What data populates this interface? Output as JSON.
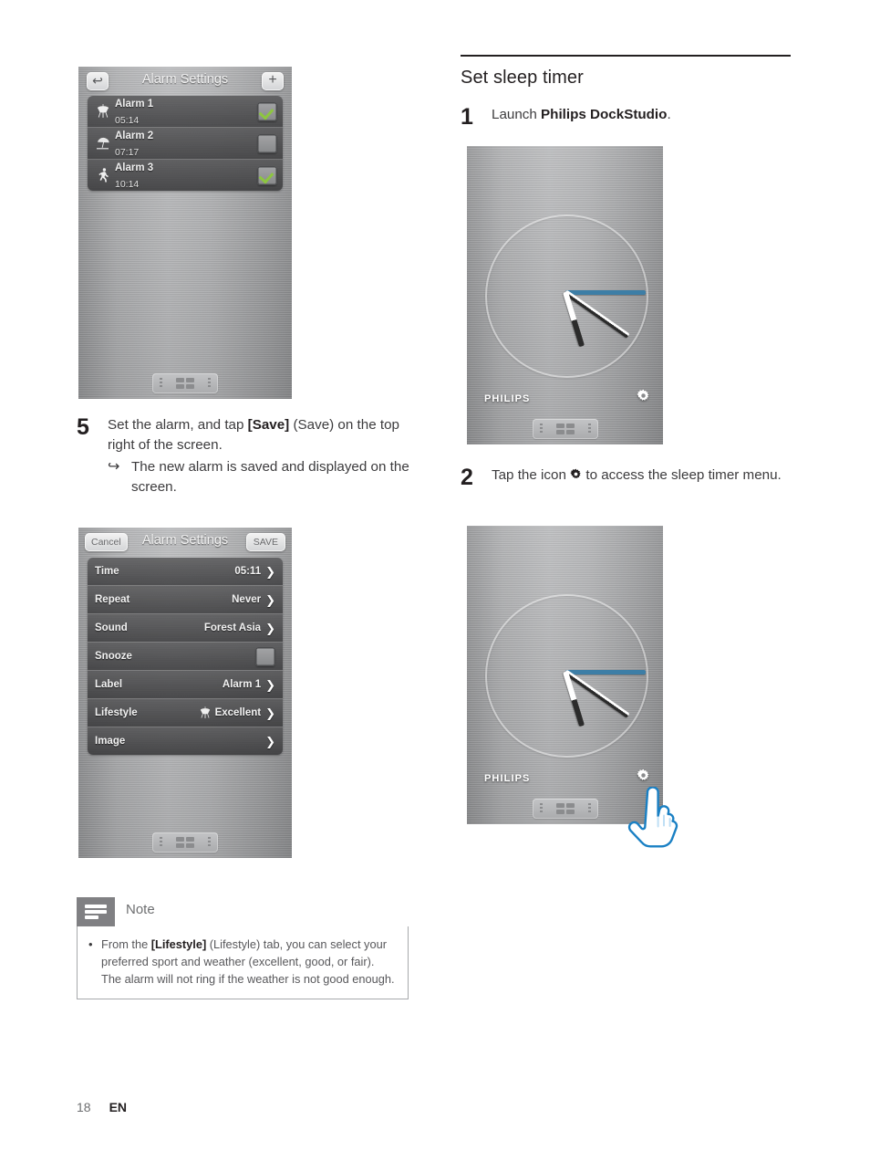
{
  "page": {
    "number": "18",
    "language": "EN"
  },
  "left_column": {
    "alarm_list_screen": {
      "name": "alarm-settings-list",
      "title": "Alarm Settings",
      "back_button": "↩",
      "add_button": "+",
      "alarms": [
        {
          "icon": "bbq-grill-icon",
          "name": "Alarm 1",
          "time": "05:14",
          "enabled": true
        },
        {
          "icon": "beach-umbrella-icon",
          "name": "Alarm 2",
          "time": "07:17",
          "enabled": false
        },
        {
          "icon": "running-person-icon",
          "name": "Alarm 3",
          "time": "10:14",
          "enabled": true
        }
      ]
    },
    "step5": {
      "number": "5",
      "text_a": "Set the alarm, and tap ",
      "text_b": "[Save]",
      "text_c": " (Save) on the top right of the screen.",
      "sub_arrow": "↪",
      "sub_text": "The new alarm is saved and displayed on the screen."
    },
    "alarm_edit_screen": {
      "name": "alarm-settings-edit",
      "title": "Alarm Settings",
      "cancel_button": "Cancel",
      "save_button": "SAVE",
      "rows": [
        {
          "label": "Time",
          "value": "05:11",
          "chevron": "❯",
          "control": "chevron"
        },
        {
          "label": "Repeat",
          "value": "Never",
          "chevron": "❯",
          "control": "chevron"
        },
        {
          "label": "Sound",
          "value": "Forest Asia",
          "chevron": "❯",
          "control": "chevron"
        },
        {
          "label": "Snooze",
          "value": "",
          "chevron": "",
          "control": "checkbox"
        },
        {
          "label": "Label",
          "value": "Alarm 1",
          "chevron": "❯",
          "control": "chevron"
        },
        {
          "label": "Lifestyle",
          "value": "Excellent",
          "chevron": "❯",
          "control": "chevron-icon",
          "icon": "bbq-grill-icon"
        },
        {
          "label": "Image",
          "value": "",
          "chevron": "❯",
          "control": "chevron"
        }
      ]
    },
    "note": {
      "title": "Note",
      "icon": "note-lines-icon",
      "bullet": "•",
      "text_a": "From the ",
      "text_b": "[Lifestyle]",
      "text_c": " (Lifestyle) tab, you can select your preferred sport and weather (excellent, good, or fair). The alarm will not ring if the weather is not good enough."
    }
  },
  "right_column": {
    "section_title": "Set sleep timer",
    "step1": {
      "number": "1",
      "text_a": "Launch ",
      "text_b": "Philips DockStudio",
      "text_c": "."
    },
    "step2": {
      "number": "2",
      "text_a": "Tap the icon ",
      "icon": "gear-icon",
      "text_c": " to access the sleep timer menu."
    },
    "clock_screen_1": {
      "name": "philips-dockstudio-clock",
      "brand": "PHILIPS",
      "gear_icon": "gear-icon",
      "hands": {
        "second_deg": 0,
        "minute_deg": 35,
        "hour_deg": 73
      }
    },
    "clock_screen_2": {
      "name": "philips-dockstudio-clock-tap",
      "brand": "PHILIPS",
      "gear_icon": "gear-icon",
      "cursor": "pointing-hand-cursor",
      "hands": {
        "second_deg": 0,
        "minute_deg": 35,
        "hour_deg": 73
      }
    }
  },
  "colors": {
    "accent_green": "#8dc63f",
    "clock_second_hand": "#3d7ea6",
    "note_header": "#808083",
    "text": "#231f20"
  }
}
